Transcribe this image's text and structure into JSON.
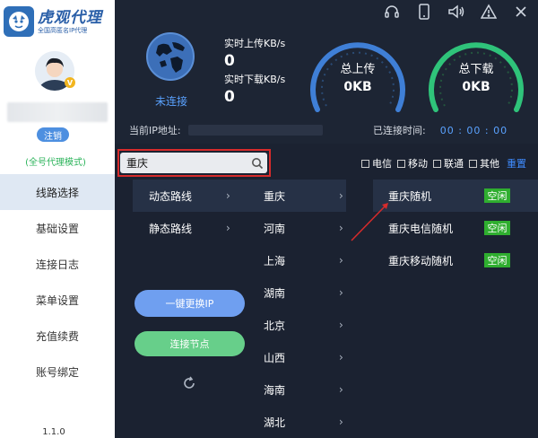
{
  "app": {
    "brand_name": "虎观代理",
    "brand_sub": "全国高匿名IP代理",
    "version": "1.1.0"
  },
  "user": {
    "vip_badge": "V",
    "logout_label": "注销",
    "mode_label": "(全号代理模式)"
  },
  "sidebar": {
    "items": [
      {
        "label": "线路选择",
        "active": true
      },
      {
        "label": "基础设置"
      },
      {
        "label": "连接日志"
      },
      {
        "label": "菜单设置"
      },
      {
        "label": "充值续费"
      },
      {
        "label": "账号绑定"
      }
    ]
  },
  "status": {
    "connection": "未连接",
    "upload_label": "实时上传KB/s",
    "upload_value": "0",
    "download_label": "实时下载KB/s",
    "download_value": "0",
    "total_upload_title": "总上传",
    "total_upload_value": "0KB",
    "total_download_title": "总下载",
    "total_download_value": "0KB",
    "ip_label": "当前IP地址:",
    "time_label": "已连接时间:",
    "time_value": "00 : 00 : 00"
  },
  "search": {
    "value": "重庆"
  },
  "filters": {
    "options": [
      "电信",
      "移动",
      "联通",
      "其他"
    ],
    "reset_label": "重置"
  },
  "routes": [
    "动态路线",
    "静态路线"
  ],
  "cities": [
    "重庆",
    "河南",
    "上海",
    "湖南",
    "北京",
    "山西",
    "海南",
    "湖北"
  ],
  "nodes": [
    {
      "name": "重庆随机",
      "status": "空闲"
    },
    {
      "name": "重庆电信随机",
      "status": "空闲"
    },
    {
      "name": "重庆移动随机",
      "status": "空闲"
    }
  ],
  "actions": {
    "change_ip": "一键更换IP",
    "connect_node": "连接节点"
  },
  "colors": {
    "accent": "#3f8cff",
    "upload_gauge": "#3f7fd6",
    "download_gauge": "#2fc37a",
    "free_badge": "#2fae2f",
    "highlight": "#d62b2b"
  },
  "icons": [
    "headset-icon",
    "phone-icon",
    "volume-icon",
    "warning-icon",
    "close-icon",
    "globe-icon",
    "search-icon",
    "refresh-icon"
  ]
}
